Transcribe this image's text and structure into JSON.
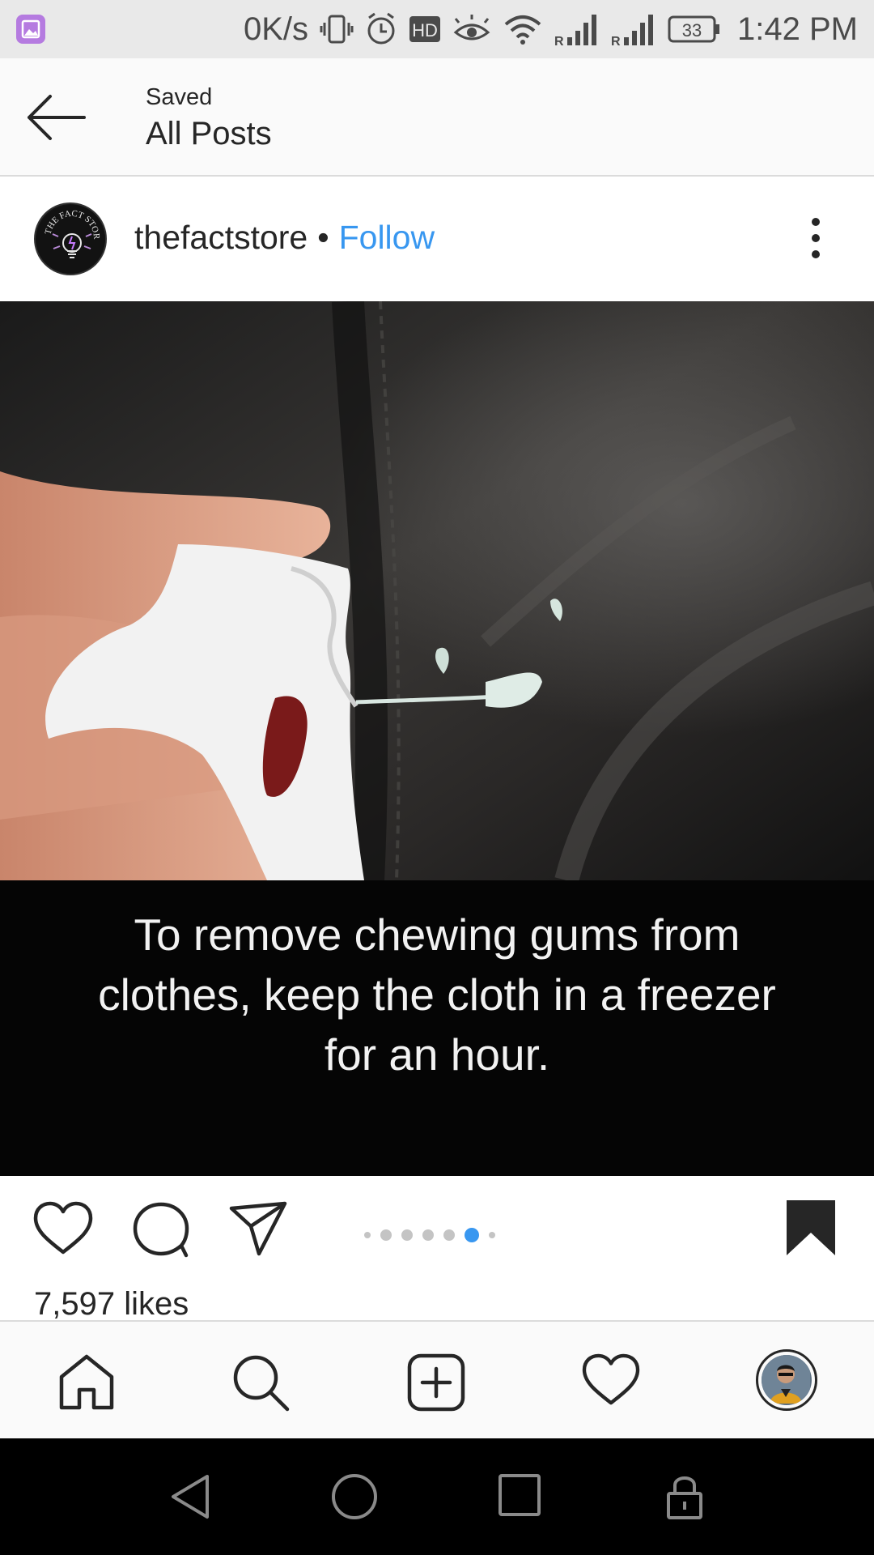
{
  "status_bar": {
    "net_speed": "0K/s",
    "hd_label": "HD",
    "signal_1_label": "R",
    "signal_2_label": "R",
    "battery": "33",
    "time": "1:42 PM"
  },
  "header": {
    "subtitle": "Saved",
    "title": "All Posts"
  },
  "post": {
    "username": "thefactstore",
    "separator": "•",
    "follow_label": "Follow",
    "avatar_text": "THE FACT STORE",
    "caption_lines": [
      "To remove chewing gums from",
      "clothes, keep the cloth in a freezer",
      "for an hour."
    ],
    "likes": "7,597 likes",
    "carousel": {
      "count": 7,
      "active_index": 5
    }
  },
  "colors": {
    "accent": "#3897f0",
    "text": "#262626",
    "status_bg": "#e9e9e9",
    "header_bg": "#fafafa"
  },
  "icons": {
    "back": "arrow-left-icon",
    "more": "more-vertical-icon",
    "like": "heart-icon",
    "comment": "comment-icon",
    "share": "paper-plane-icon",
    "save": "bookmark-filled-icon",
    "home": "home-icon",
    "search": "search-icon",
    "new_post": "plus-square-icon",
    "activity": "heart-icon",
    "profile": "avatar"
  }
}
